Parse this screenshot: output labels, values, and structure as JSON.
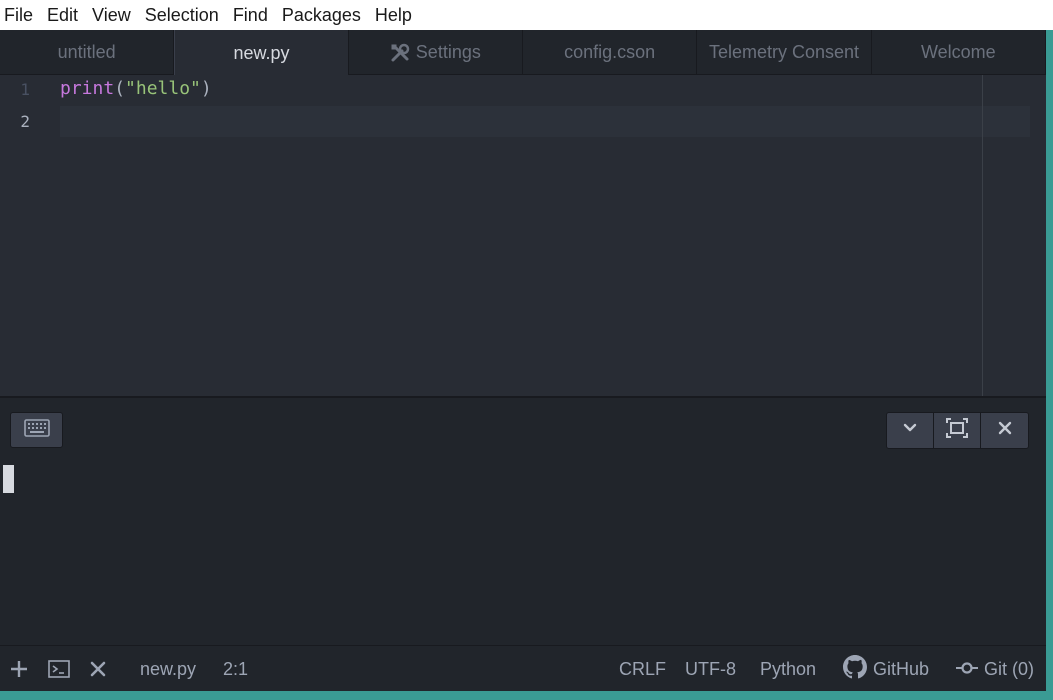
{
  "menu": {
    "items": [
      "File",
      "Edit",
      "View",
      "Selection",
      "Find",
      "Packages",
      "Help"
    ]
  },
  "tabs": [
    {
      "label": "untitled",
      "icon": null,
      "active": false
    },
    {
      "label": "new.py",
      "icon": null,
      "active": true
    },
    {
      "label": "Settings",
      "icon": "tools-icon",
      "active": false
    },
    {
      "label": "config.cson",
      "icon": null,
      "active": false
    },
    {
      "label": "Telemetry Consent",
      "icon": null,
      "active": false
    },
    {
      "label": "Welcome",
      "icon": null,
      "active": false
    }
  ],
  "editor": {
    "line_numbers": [
      "1",
      "2"
    ],
    "current_line": 2,
    "code": {
      "fn": "print",
      "open": "(",
      "string": "\"hello\"",
      "close": ")"
    }
  },
  "terminal": {
    "keyboard_button_icon": "keyboard-icon",
    "controls": [
      "chevron-down-icon",
      "maximize-icon",
      "close-icon"
    ]
  },
  "status": {
    "left_icons": [
      "plus-icon",
      "terminal-icon",
      "close-icon"
    ],
    "file_name": "new.py",
    "cursor_position": "2:1",
    "line_ending": "CRLF",
    "encoding": "UTF-8",
    "grammar": "Python",
    "github_label": "GitHub",
    "git_label": "Git (0)"
  },
  "colors": {
    "accent_strip": "#3a9b94",
    "editor_bg": "#282c34",
    "keyword": "#c678dd",
    "string": "#98c379"
  }
}
